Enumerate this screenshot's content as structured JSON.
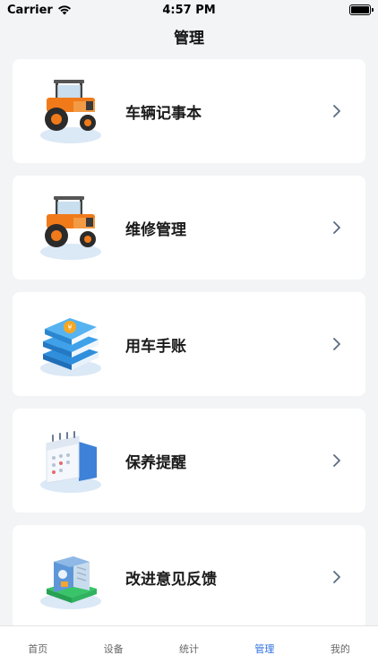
{
  "status_bar": {
    "carrier": "Carrier",
    "time": "4:57 PM"
  },
  "nav": {
    "title": "管理"
  },
  "menu": [
    {
      "label": "车辆记事本",
      "icon": "tractor-icon"
    },
    {
      "label": "维修管理",
      "icon": "tractor-icon"
    },
    {
      "label": "用车手账",
      "icon": "ledger-books-icon"
    },
    {
      "label": "保养提醒",
      "icon": "calendar-icon"
    },
    {
      "label": "改进意见反馈",
      "icon": "feedback-box-icon"
    }
  ],
  "tabs": [
    {
      "label": "首页",
      "active": false
    },
    {
      "label": "设备",
      "active": false
    },
    {
      "label": "统计",
      "active": false
    },
    {
      "label": "管理",
      "active": true
    },
    {
      "label": "我的",
      "active": false
    }
  ],
  "colors": {
    "accent": "#2f6fe0",
    "background": "#f2f4f6",
    "card": "#ffffff"
  }
}
